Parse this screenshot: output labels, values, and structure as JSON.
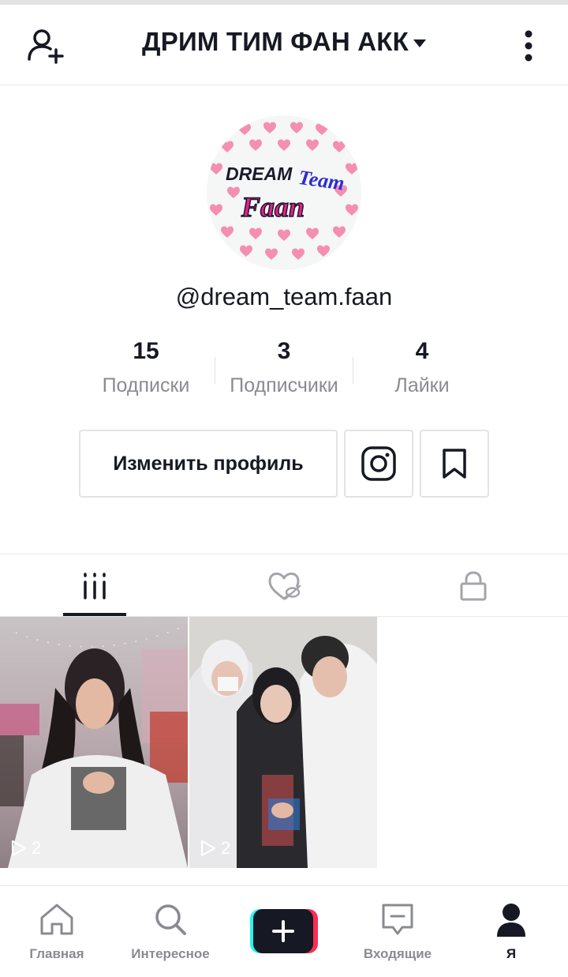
{
  "header": {
    "title": "ДРИМ ТИМ ФАН АКК",
    "add_friend_icon": "person-plus-icon",
    "menu_icon": "vertical-dots-icon"
  },
  "profile": {
    "avatar_text_line1": "DREAM",
    "avatar_text_line2": "Team",
    "avatar_text_line3": "Faan",
    "username": "@dream_team.faan"
  },
  "stats": [
    {
      "value": "15",
      "label": "Подписки"
    },
    {
      "value": "3",
      "label": "Подписчики"
    },
    {
      "value": "4",
      "label": "Лайки"
    }
  ],
  "actions": {
    "edit_profile": "Изменить профиль",
    "instagram_icon": "instagram-icon",
    "bookmark_icon": "bookmark-icon"
  },
  "tabs": [
    {
      "icon": "grid-icon",
      "active": true
    },
    {
      "icon": "liked-hidden-icon",
      "active": false
    },
    {
      "icon": "lock-icon",
      "active": false
    }
  ],
  "videos": [
    {
      "views": "2"
    },
    {
      "views": "2"
    }
  ],
  "nav": [
    {
      "label": "Главная",
      "icon": "home-icon"
    },
    {
      "label": "Интересное",
      "icon": "search-icon"
    },
    {
      "label": "",
      "icon": "plus-icon"
    },
    {
      "label": "Входящие",
      "icon": "inbox-icon"
    },
    {
      "label": "Я",
      "icon": "profile-icon",
      "active": true
    }
  ],
  "colors": {
    "text": "#161823",
    "muted": "#8a8b91",
    "accent_pink": "#fe2c55",
    "accent_cyan": "#25f4ee",
    "heart_pink": "#f48fb1"
  }
}
